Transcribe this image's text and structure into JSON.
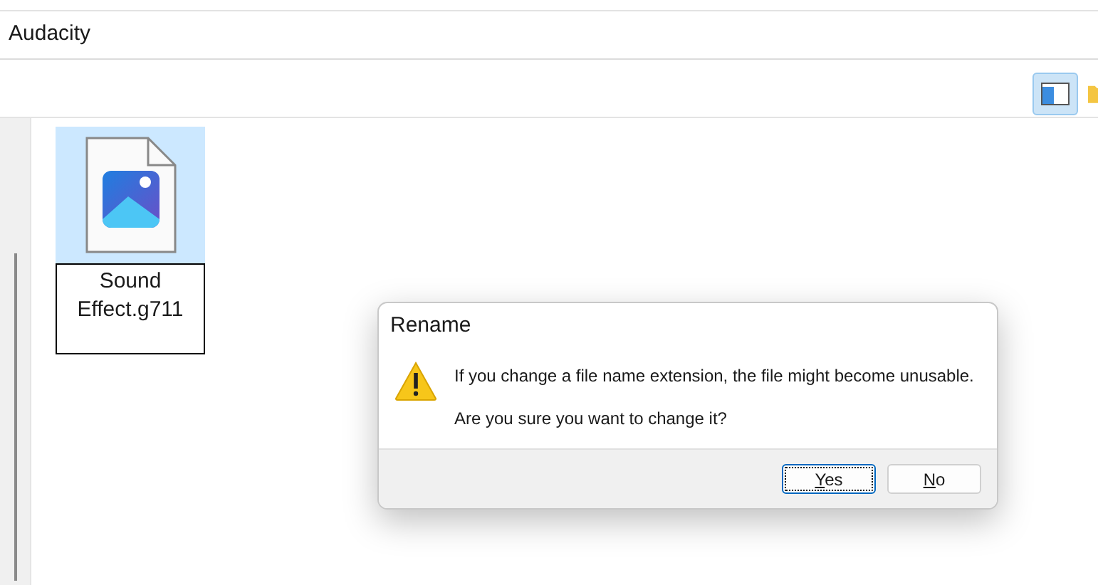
{
  "address_bar": {
    "path": "Audacity"
  },
  "toolbar": {
    "view_buttons": [
      {
        "kind": "details-pane",
        "selected": true
      },
      {
        "kind": "folder",
        "selected": false
      }
    ]
  },
  "files": [
    {
      "name": "Sound Effect.g711",
      "selected": true,
      "renaming": true
    }
  ],
  "dialog": {
    "title": "Rename",
    "message": "If you change a file name extension, the file might become unusable.",
    "question": "Are you sure you want to change it?",
    "buttons": [
      {
        "label": "Yes",
        "focused": true
      },
      {
        "label": "No",
        "focused": false
      }
    ]
  }
}
